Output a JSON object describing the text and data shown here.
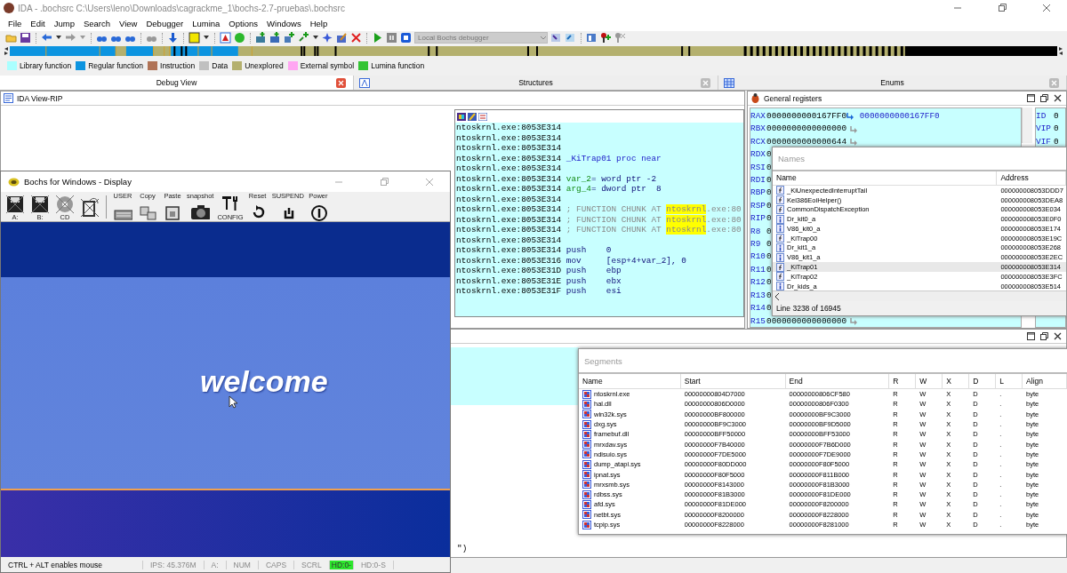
{
  "window": {
    "title": "IDA - .bochsrc C:\\Users\\leno\\Downloads\\cagrackme_1\\bochs-2.7-pruebas\\.bochsrc"
  },
  "menu": [
    "File",
    "Edit",
    "Jump",
    "Search",
    "View",
    "Debugger",
    "Lumina",
    "Options",
    "Windows",
    "Help"
  ],
  "toolbar": {
    "debugger_combo": {
      "value": "Local Bochs debugger",
      "disabled": true
    }
  },
  "legend": [
    {
      "label": "Library function",
      "color": "#aaffff"
    },
    {
      "label": "Regular function",
      "color": "#0c94e0"
    },
    {
      "label": "Instruction",
      "color": "#b07356"
    },
    {
      "label": "Data",
      "color": "#c0c0c0"
    },
    {
      "label": "Unexplored",
      "color": "#b4b06e"
    },
    {
      "label": "External symbol",
      "color": "#ffa6f2"
    },
    {
      "label": "Lumina function",
      "color": "#33c433"
    }
  ],
  "tabs": [
    {
      "label": "Debug View",
      "selected": true
    },
    {
      "label": "Structures",
      "selected": false
    },
    {
      "label": "Enums",
      "selected": false
    }
  ],
  "ida_view": {
    "title": "IDA View-RIP",
    "lines": [
      {
        "kind": "plain",
        "address": "ntoskrnl.exe:8053E314"
      },
      {
        "kind": "plain",
        "address": "ntoskrnl.exe:8053E314"
      },
      {
        "kind": "plain",
        "address": "ntoskrnl.exe:8053E314"
      },
      {
        "kind": "proc",
        "address": "ntoskrnl.exe:8053E314",
        "text": "_KiTrap01 proc near"
      },
      {
        "kind": "plain",
        "address": "ntoskrnl.exe:8053E314"
      },
      {
        "kind": "var",
        "address": "ntoskrnl.exe:8053E314",
        "name": "var_2",
        "text": "= word ptr -2"
      },
      {
        "kind": "var",
        "address": "ntoskrnl.exe:8053E314",
        "name": "arg_4",
        "text": "= dword ptr  8"
      },
      {
        "kind": "plain",
        "address": "ntoskrnl.exe:8053E314"
      },
      {
        "kind": "comment",
        "address": "ntoskrnl.exe:8053E314",
        "text": "; FUNCTION CHUNK AT ",
        "highlight": "ntoskrnl",
        "tail": ".exe:80"
      },
      {
        "kind": "comment",
        "address": "ntoskrnl.exe:8053E314",
        "text": "; FUNCTION CHUNK AT ",
        "highlight": "ntoskrnl",
        "tail": ".exe:80"
      },
      {
        "kind": "comment",
        "address": "ntoskrnl.exe:8053E314",
        "text": "; FUNCTION CHUNK AT ",
        "highlight": "ntoskrnl",
        "tail": ".exe:80"
      },
      {
        "kind": "plain",
        "address": "ntoskrnl.exe:8053E314"
      },
      {
        "kind": "insn",
        "address": "ntoskrnl.exe:8053E314",
        "mnemonic": "push",
        "operands": "0"
      },
      {
        "kind": "insn",
        "address": "ntoskrnl.exe:8053E316",
        "mnemonic": "mov",
        "operands": "[esp+4+var_2], 0"
      },
      {
        "kind": "insn",
        "address": "ntoskrnl.exe:8053E31D",
        "mnemonic": "push",
        "operands": "ebp"
      },
      {
        "kind": "insn",
        "address": "ntoskrnl.exe:8053E31E",
        "mnemonic": "push",
        "operands": "ebx"
      },
      {
        "kind": "insn",
        "address": "ntoskrnl.exe:8053E31F",
        "mnemonic": "push",
        "operands": "esi"
      }
    ]
  },
  "registers": {
    "title": "General registers",
    "rows": [
      {
        "name": "RAX",
        "value": "0000000000167FF0",
        "target": "0000000000167FF0"
      },
      {
        "name": "RBX",
        "value": "0000000000000000",
        "arrow": true
      },
      {
        "name": "RCX",
        "value": "0000000000000644",
        "arrow": true
      },
      {
        "name": "RDX",
        "value": "0"
      },
      {
        "name": "RSI",
        "value": "0"
      },
      {
        "name": "RDI",
        "value": "0"
      },
      {
        "name": "RBP",
        "value": "0"
      },
      {
        "name": "RSP",
        "value": "0"
      },
      {
        "name": "RIP",
        "value": "0"
      },
      {
        "name": "R8",
        "value": "0"
      },
      {
        "name": "R9",
        "value": "0"
      },
      {
        "name": "R10",
        "value": "0"
      },
      {
        "name": "R11",
        "value": "0"
      },
      {
        "name": "R12",
        "value": "0"
      },
      {
        "name": "R13",
        "value": "0"
      },
      {
        "name": "R14",
        "value": "0"
      },
      {
        "name": "R15",
        "value": "0000000000000000",
        "arrow": true
      }
    ],
    "flags": [
      {
        "name": "ID",
        "value": "0"
      },
      {
        "name": "VIP",
        "value": "0"
      },
      {
        "name": "VIF",
        "value": "0"
      }
    ]
  },
  "names": {
    "title": "Names",
    "columns": [
      "Name",
      "Address"
    ],
    "rows": [
      {
        "kind": "function",
        "name": "_KiUnexpectedInterruptTail",
        "address": "000000008053DDD7",
        "selected": false
      },
      {
        "kind": "function",
        "name": "Kei386EoiHelper()",
        "address": "000000008053DEA8",
        "selected": false
      },
      {
        "kind": "function",
        "name": "CommonDispatchException",
        "address": "000000008053E034",
        "selected": false
      },
      {
        "kind": "item",
        "name": "Dr_kit0_a",
        "address": "000000008053E0F0",
        "selected": false
      },
      {
        "kind": "item",
        "name": "V86_kit0_a",
        "address": "000000008053E174",
        "selected": false
      },
      {
        "kind": "function",
        "name": "_KiTrap00",
        "address": "000000008053E19C",
        "selected": false
      },
      {
        "kind": "item",
        "name": "Dr_kit1_a",
        "address": "000000008053E268",
        "selected": false
      },
      {
        "kind": "item",
        "name": "V86_kit1_a",
        "address": "000000008053E2EC",
        "selected": false
      },
      {
        "kind": "function",
        "name": "_KiTrap01",
        "address": "000000008053E314",
        "selected": true
      },
      {
        "kind": "function",
        "name": "_KiTrap02",
        "address": "000000008053E3FC",
        "selected": false
      },
      {
        "kind": "item",
        "name": "Dr_kids_a",
        "address": "000000008053E514",
        "selected": false
      }
    ],
    "status": "Line 3238 of 16945"
  },
  "output": {
    "text": "\")"
  },
  "segments": {
    "title": "Segments",
    "columns": [
      "Name",
      "Start",
      "End",
      "R",
      "W",
      "X",
      "D",
      "L",
      "Align"
    ],
    "rows": [
      [
        "ntoskrnl.exe",
        "00000000804D7000",
        "00000000806CF580",
        "R",
        "W",
        "X",
        "D",
        ".",
        "byte"
      ],
      [
        "hal.dll",
        "00000000806D0000",
        "00000000806F0300",
        "R",
        "W",
        "X",
        "D",
        ".",
        "byte"
      ],
      [
        "win32k.sys",
        "00000000BF800000",
        "00000000BF9C3000",
        "R",
        "W",
        "X",
        "D",
        ".",
        "byte"
      ],
      [
        "dxg.sys",
        "00000000BF9C3000",
        "00000000BF9D5000",
        "R",
        "W",
        "X",
        "D",
        ".",
        "byte"
      ],
      [
        "framebuf.dll",
        "00000000BFF50000",
        "00000000BFF53000",
        "R",
        "W",
        "X",
        "D",
        ".",
        "byte"
      ],
      [
        "mrxdav.sys",
        "00000000F7B40000",
        "00000000F7B6D000",
        "R",
        "W",
        "X",
        "D",
        ".",
        "byte"
      ],
      [
        "ndisuio.sys",
        "00000000F7DE5000",
        "00000000F7DE9000",
        "R",
        "W",
        "X",
        "D",
        ".",
        "byte"
      ],
      [
        "dump_atapi.sys",
        "00000000F80DD000",
        "00000000F80F5000",
        "R",
        "W",
        "X",
        "D",
        ".",
        "byte"
      ],
      [
        "ipnat.sys",
        "00000000F80F5000",
        "00000000F811B000",
        "R",
        "W",
        "X",
        "D",
        ".",
        "byte"
      ],
      [
        "mrxsmb.sys",
        "00000000F8143000",
        "00000000F81B3000",
        "R",
        "W",
        "X",
        "D",
        ".",
        "byte"
      ],
      [
        "rdbss.sys",
        "00000000F81B3000",
        "00000000F81DE000",
        "R",
        "W",
        "X",
        "D",
        ".",
        "byte"
      ],
      [
        "afd.sys",
        "00000000F81DE000",
        "00000000F8200000",
        "R",
        "W",
        "X",
        "D",
        ".",
        "byte"
      ],
      [
        "netbt.sys",
        "00000000F8200000",
        "00000000F8228000",
        "R",
        "W",
        "X",
        "D",
        ".",
        "byte"
      ],
      [
        "tcpip.sys",
        "00000000F8228000",
        "00000000F8281000",
        "R",
        "W",
        "X",
        "D",
        ".",
        "byte"
      ]
    ]
  },
  "bochs": {
    "title": "Bochs for Windows - Display",
    "toolbar": [
      {
        "kind": "floppy",
        "label": "A:"
      },
      {
        "kind": "floppy",
        "label": "B:"
      },
      {
        "kind": "cd",
        "label": "CD"
      },
      {
        "kind": "disk"
      },
      {
        "kind": "keyboard",
        "label": "USER"
      },
      {
        "kind": "copy",
        "label": "Copy"
      },
      {
        "kind": "paste",
        "label": "Paste"
      },
      {
        "kind": "camera",
        "label": "snapshot"
      },
      {
        "kind": "config",
        "label": "CONFIG"
      },
      {
        "kind": "reset",
        "label": "Reset"
      },
      {
        "kind": "suspend",
        "label": "SUSPEND"
      },
      {
        "kind": "power",
        "label": "Power"
      }
    ],
    "screen_text": "welcome",
    "status": [
      {
        "text": "CTRL + ALT enables mouse",
        "active": false
      },
      {
        "text": "IPS: 45.376M",
        "active": false
      },
      {
        "text": "A:",
        "active": false
      },
      {
        "text": "NUM",
        "active": false
      },
      {
        "text": "CAPS",
        "active": false
      },
      {
        "text": "SCRL",
        "active": false
      },
      {
        "text": "HD:0-",
        "active": true
      },
      {
        "text": "HD:0-S",
        "active": false
      }
    ]
  }
}
